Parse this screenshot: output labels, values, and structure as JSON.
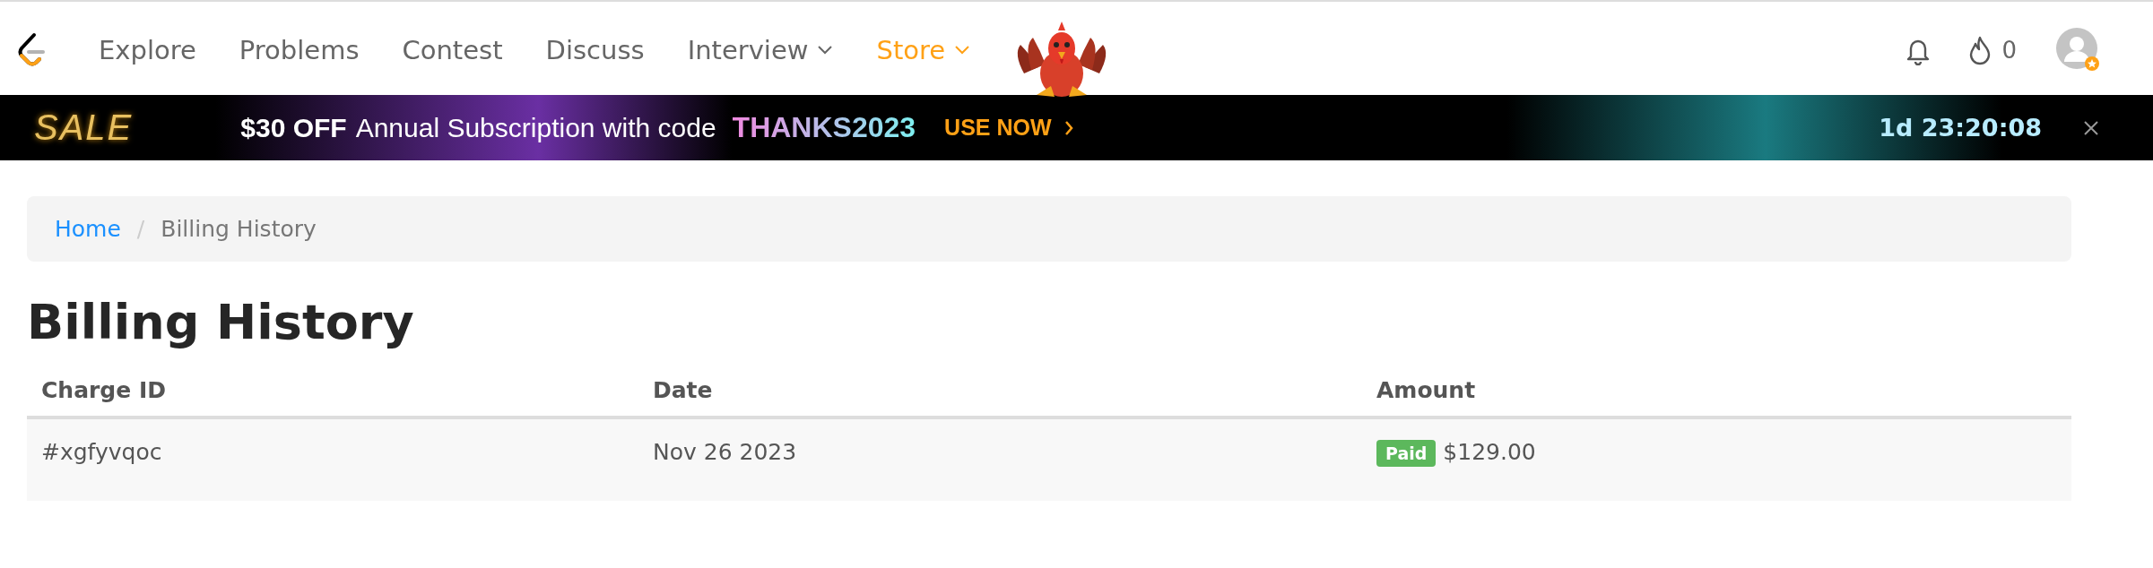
{
  "nav": {
    "items": [
      {
        "label": "Explore",
        "selected": false,
        "dropdown": false
      },
      {
        "label": "Problems",
        "selected": false,
        "dropdown": false
      },
      {
        "label": "Contest",
        "selected": false,
        "dropdown": false
      },
      {
        "label": "Discuss",
        "selected": false,
        "dropdown": false
      },
      {
        "label": "Interview",
        "selected": false,
        "dropdown": true
      },
      {
        "label": "Store",
        "selected": true,
        "dropdown": true
      }
    ],
    "streak": "0"
  },
  "banner": {
    "sale": "SALE",
    "offer": "$30 OFF",
    "text": "Annual Subscription with code",
    "code": "THANKS2023",
    "cta": "USE NOW",
    "countdown": "1d 23:20:08"
  },
  "breadcrumb": [
    {
      "label": "Home",
      "kind": "link"
    },
    {
      "label": "/",
      "kind": "separator"
    },
    {
      "label": "Billing History",
      "kind": "current"
    }
  ],
  "title": "Billing History",
  "table": {
    "columns": [
      "Charge ID",
      "Date",
      "Amount"
    ],
    "rows": [
      {
        "charge_id": "#xgfyvqoc",
        "date": "Nov 26 2023",
        "status": "Paid",
        "amount": "$129.00"
      }
    ]
  }
}
